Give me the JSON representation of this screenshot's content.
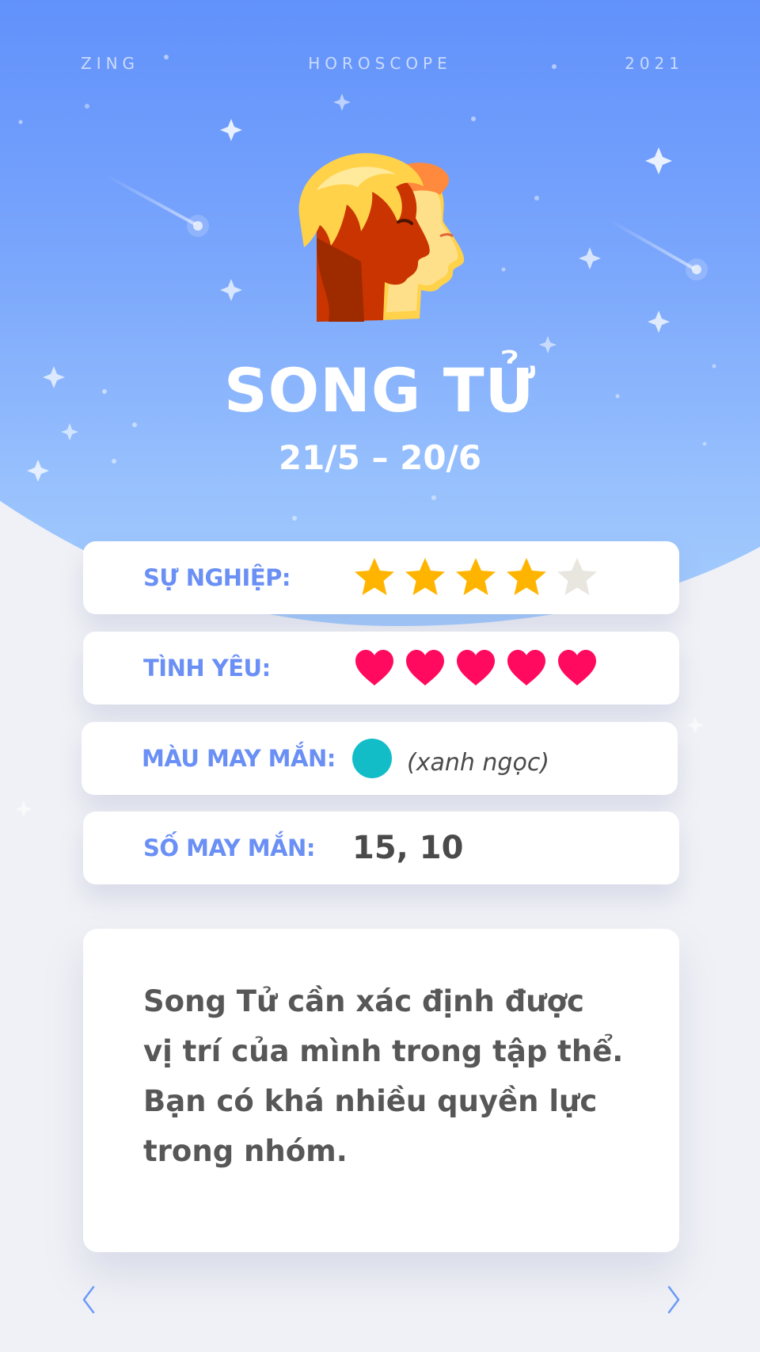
{
  "header": {
    "brand": "ZING",
    "section": "HOROSCOPE",
    "year": "2021"
  },
  "sign": {
    "name": "SONG TỬ",
    "dates": "21/5 – 20/6",
    "icon": "gemini-twins-icon"
  },
  "stats": {
    "career": {
      "label": "SỰ NGHIỆP:",
      "rating": 4,
      "max": 5,
      "icon": "star-icon"
    },
    "love": {
      "label": "TÌNH YÊU:",
      "rating": 5,
      "max": 5,
      "icon": "heart-icon"
    },
    "lucky_color": {
      "label": "MÀU MAY MẮN:",
      "swatch": "#13bdc8",
      "name": "(xanh ngọc)"
    },
    "lucky_number": {
      "label": "SỐ MAY MẮN:",
      "value": "15, 10"
    }
  },
  "message": "Song Tử cần xác định được\nvị trí của mình trong tập thể.\nBạn có khá nhiều quyền lực\ntrong nhóm.",
  "nav": {
    "prev_icon": "chevron-left-icon",
    "next_icon": "chevron-right-icon"
  },
  "colors": {
    "accent": "#6a8ff5",
    "star": "#ffb500",
    "star_empty": "#e8e6df",
    "heart": "#ff0a5e",
    "sky_top": "#6191fb",
    "sky_bottom": "#a7cffd"
  }
}
